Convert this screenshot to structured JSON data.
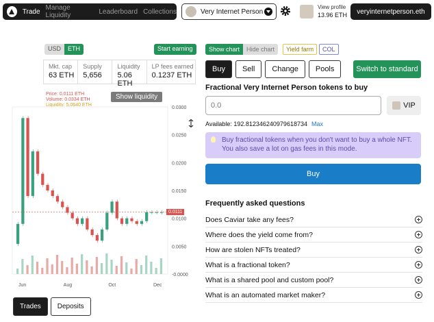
{
  "nav": {
    "items": [
      "Trade",
      "Manage Liquidity",
      "Leaderboard",
      "Collections"
    ]
  },
  "identity": {
    "name": "Very Internet Person"
  },
  "profile": {
    "link": "View profile",
    "balance": "13.96 ETH"
  },
  "wallet": {
    "name": "veryinternetperson.eth"
  },
  "currency": {
    "options": [
      "USD",
      "ETH"
    ],
    "selected": "ETH"
  },
  "start_earning": "Start earning",
  "stats": [
    {
      "label": "Mkt. cap",
      "value": "63 ETH"
    },
    {
      "label": "Supply",
      "value": "5,656"
    },
    {
      "label": "Liquidity",
      "value": "5.06 ETH"
    },
    {
      "label": "LP fees earned",
      "value": "0.1237 ETH"
    }
  ],
  "ohlc": {
    "price": "Price: 0.0111 ETH",
    "volume": "Volume: 0.0334 ETH",
    "liquidity": "Liquidity: 5.0640 ETH"
  },
  "show_liquidity": "Show liquidity",
  "price_tag": "0.0111",
  "chart_data": {
    "type": "line",
    "x_ticks": [
      "Jun",
      "Aug",
      "Oct",
      "Dec"
    ],
    "y_ticks": [
      "0.0300",
      "0.0250",
      "0.0200",
      "0.0150",
      "0.0100",
      "0.0050",
      "-0.0000"
    ],
    "ylim": [
      0,
      0.03
    ],
    "series": [
      {
        "values": [
          0.009,
          0.028,
          0.014,
          0.022,
          0.018,
          0.016,
          0.015,
          0.014,
          0.013,
          0.012,
          0.011,
          0.01,
          0.009,
          0.01,
          0.008,
          0.007,
          0.006,
          0.008,
          0.011,
          0.013,
          0.01,
          0.009,
          0.01,
          0.0095,
          0.009,
          0.0095,
          0.0111,
          0.0111,
          0.0111,
          0.0111
        ]
      }
    ],
    "current": 0.0111,
    "colors": {
      "up": "#3aa17e",
      "down": "#d9534f"
    }
  },
  "bottom_tabs": [
    "Trades",
    "Deposits"
  ],
  "chart_toggle": [
    "Show chart",
    "Hide chart"
  ],
  "tags": {
    "yield": "Yield farm",
    "col": "COL"
  },
  "action_tabs": [
    "Buy",
    "Sell",
    "Change",
    "Pools"
  ],
  "switch_standard": "Switch to standard",
  "buy_title": "Fractional Very Internet Person tokens to buy",
  "amount_placeholder": "0.0",
  "vip": "VIP",
  "available": {
    "text": "Available: 192.812346240979618734",
    "max": "Max"
  },
  "info": "Buy fractional tokens when you don't want to buy a whole NFT. You also save a lot on gas fees in this mode.",
  "buy_button": "Buy",
  "faq": {
    "title": "Frequently asked questions",
    "items": [
      "Does Caviar take any fees?",
      "Where does the yield come from?",
      "How are stolen NFTs treated?",
      "What is a fractional token?",
      "What is a shared pool and custom pool?",
      "What is an automated market maker?"
    ]
  }
}
